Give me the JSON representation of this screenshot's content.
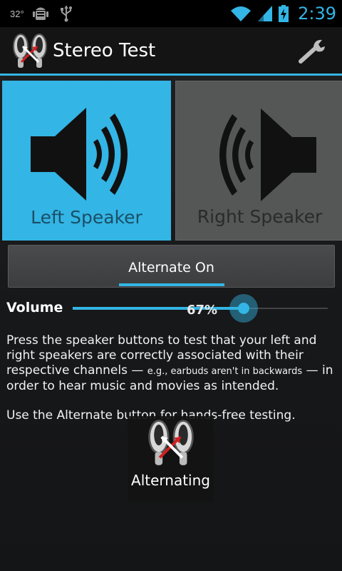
{
  "status_bar": {
    "temperature": "32°",
    "time": "2:39",
    "icons": [
      "android-debug-icon",
      "usb-icon",
      "wifi-icon",
      "signal-icon",
      "battery-charging-icon"
    ],
    "accent": "#33b5e5"
  },
  "action_bar": {
    "title": "Stereo Test",
    "logo_icon": "earbuds-logo-icon",
    "settings_icon": "wrench-icon"
  },
  "speakers": {
    "left": {
      "label": "Left Speaker",
      "active": true,
      "bg": "#33b5e5"
    },
    "right": {
      "label": "Right Speaker",
      "active": false,
      "bg": "#555656"
    }
  },
  "alternate": {
    "label": "Alternate On",
    "on": true
  },
  "volume": {
    "label": "Volume",
    "value_text": "67%",
    "value": 0.67
  },
  "description": {
    "p1_a": "Press the speaker buttons to test that your left and right speakers are correctly associated with their respective channels — ",
    "p1_small": "e.g., earbuds aren't in backwards",
    "p1_b": " — in order to hear music and movies as intended.",
    "p2": "Use the Alternate button for hands-free testing."
  },
  "toast": {
    "label": "Alternating",
    "icon": "earbuds-logo-icon"
  }
}
